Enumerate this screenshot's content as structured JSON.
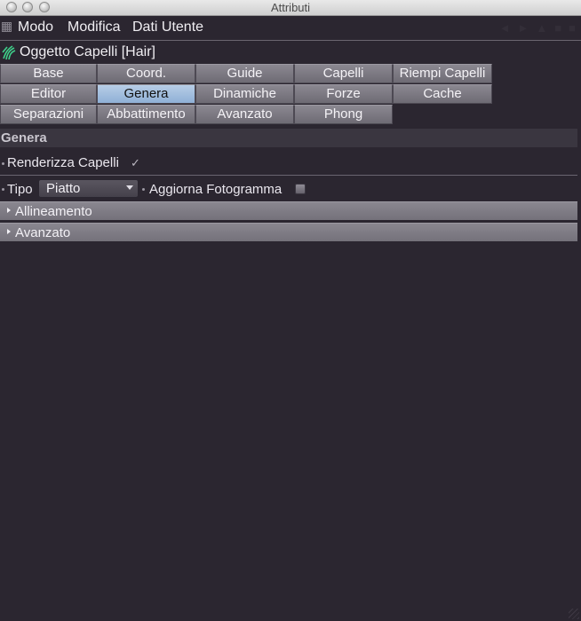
{
  "window": {
    "title": "Attributi"
  },
  "menu": {
    "items": [
      "Modo",
      "Modifica",
      "Dati Utente"
    ]
  },
  "object": {
    "name": "Oggetto Capelli [Hair]"
  },
  "tabs": [
    [
      "Base",
      "Coord.",
      "Guide",
      "Capelli",
      "Riempi Capelli"
    ],
    [
      "Editor",
      "Genera",
      "Dinamiche",
      "Forze",
      "Cache"
    ],
    [
      "Separazioni",
      "Abbattimento",
      "Avanzato",
      "Phong"
    ]
  ],
  "active_tab": "Genera",
  "section": {
    "title": "Genera"
  },
  "fields": {
    "render": {
      "label": "Renderizza Capelli",
      "checked": true,
      "mark": "✓"
    },
    "tipo": {
      "label": "Tipo",
      "value": "Piatto"
    },
    "aggiorna": {
      "label": "Aggiorna Fotogramma",
      "checked": false
    }
  },
  "groups": [
    "Allineamento",
    "Avanzato"
  ],
  "colors": {
    "background": "#2b2630",
    "active_tab": "#9fbde0",
    "tab": "#7c7982"
  }
}
